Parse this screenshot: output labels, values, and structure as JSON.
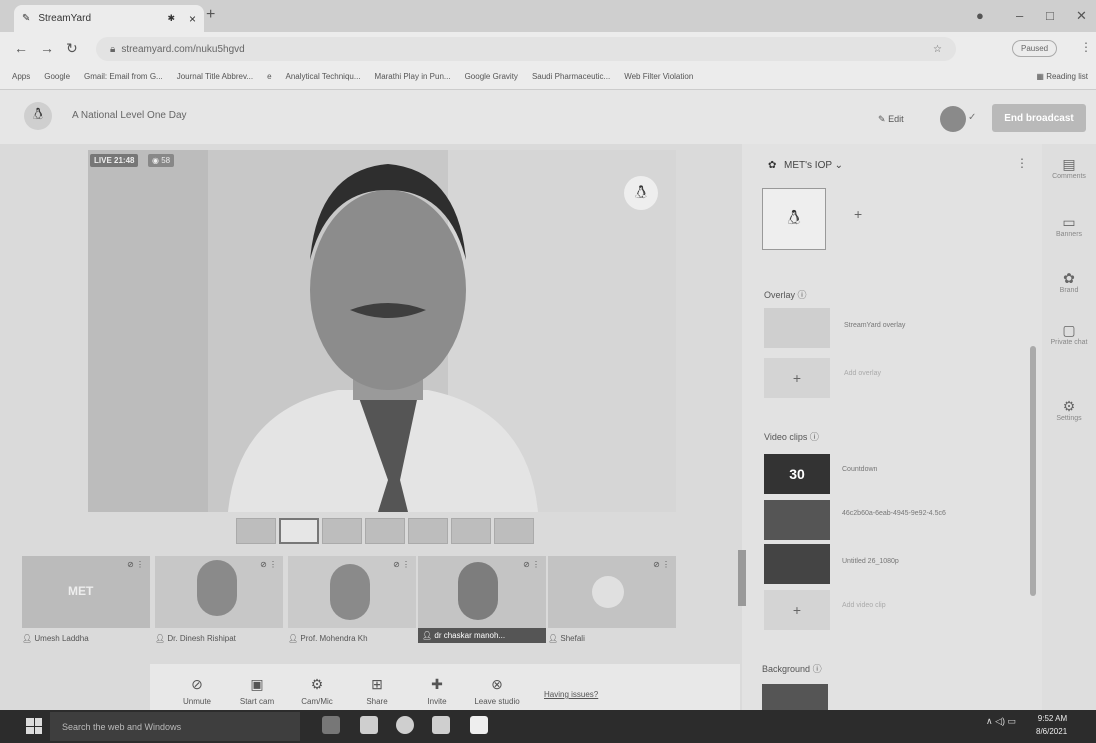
{
  "browser": {
    "tab_title": "StreamYard",
    "url": "streamyard.com/nuku5hgvd",
    "profile_label": "Paused",
    "reading_list": "Reading list",
    "bookmarks": [
      "Apps",
      "Google",
      "Gmail: Email from G...",
      "Journal Title Abbrev...",
      "e",
      "Analytical Techniqu...",
      "Marathi Play in Pun...",
      "Google Gravity",
      "Saudi Pharmaceutic...",
      "Web Filter Violation"
    ]
  },
  "header": {
    "broadcast_title": "A National Level One Day",
    "edit_label": "Edit",
    "end_button": "End broadcast"
  },
  "stage": {
    "live_badge": "LIVE 21:48",
    "viewers": "58"
  },
  "participants": [
    {
      "name": "Umesh Laddha",
      "tile_text": "MET"
    },
    {
      "name": "Dr. Dinesh Rishipat"
    },
    {
      "name": "Prof. Mohendra Kh"
    },
    {
      "name": "dr chaskar manoh..."
    },
    {
      "name": "Shefali"
    }
  ],
  "controls": [
    {
      "label": "Unmute",
      "icon": "mic-off-icon",
      "glyph": "⊘"
    },
    {
      "label": "Start cam",
      "icon": "cam-off-icon",
      "glyph": "▣"
    },
    {
      "label": "Cam/Mic",
      "icon": "gear-icon",
      "glyph": "⚙"
    },
    {
      "label": "Share",
      "icon": "share-icon",
      "glyph": "⊞"
    },
    {
      "label": "Invite",
      "icon": "invite-icon",
      "glyph": "✚"
    },
    {
      "label": "Leave studio",
      "icon": "leave-icon",
      "glyph": "⊗"
    }
  ],
  "having_issues": "Having issues?",
  "panel": {
    "brand_name": "MET's IOP",
    "overlay_title": "Overlay",
    "overlay_item": "StreamYard overlay",
    "add_overlay": "Add overlay",
    "video_clips_title": "Video clips",
    "clips": [
      {
        "thumb_text": "30",
        "name": "Countdown"
      },
      {
        "thumb_text": "",
        "name": "46c2b60a-6eab-4945-9e92-4.5c6"
      },
      {
        "thumb_text": "",
        "name": "Untitled 26_1080p"
      }
    ],
    "add_video_clip": "Add video clip",
    "background_title": "Background"
  },
  "sidenav": [
    {
      "label": "Comments",
      "icon": "comments-icon",
      "glyph": "▤"
    },
    {
      "label": "Banners",
      "icon": "banners-icon",
      "glyph": "▭"
    },
    {
      "label": "Brand",
      "icon": "brand-icon",
      "glyph": "✿"
    },
    {
      "label": "Private chat",
      "icon": "private-chat-icon",
      "glyph": "▢"
    },
    {
      "label": "Settings",
      "icon": "settings-icon",
      "glyph": "⚙"
    }
  ],
  "taskbar": {
    "search_placeholder": "Search the web and Windows",
    "time": "9:52 AM",
    "date": "8/6/2021"
  }
}
